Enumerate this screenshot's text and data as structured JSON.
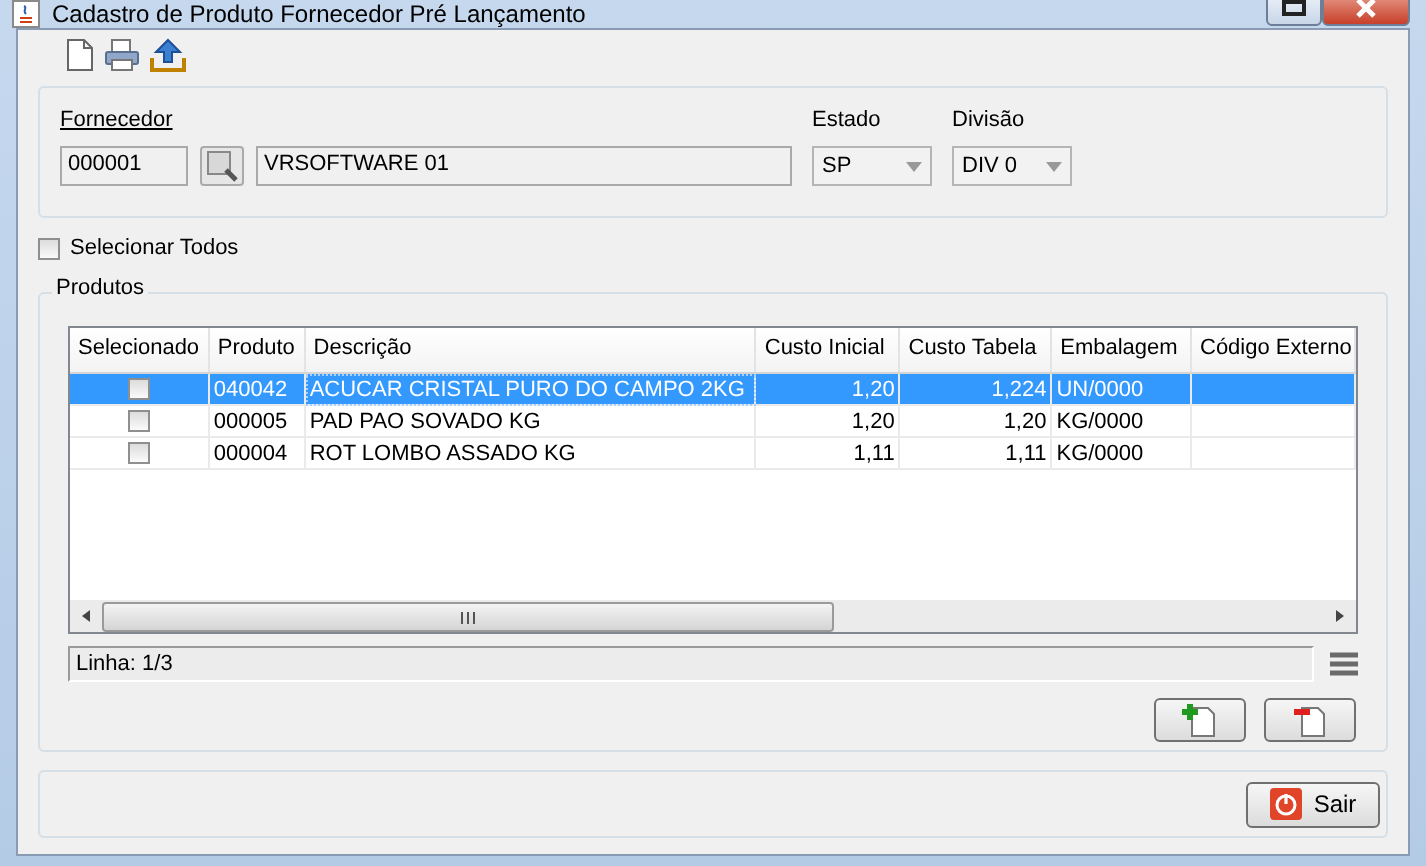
{
  "window": {
    "title": "Cadastro de Produto Fornecedor Pré Lançamento"
  },
  "fornecedor": {
    "label": "Fornecedor",
    "code": "000001",
    "name": "VRSOFTWARE 01"
  },
  "estado": {
    "label": "Estado",
    "value": "SP"
  },
  "divisao": {
    "label": "Divisão",
    "value": "DIV 0"
  },
  "select_all": {
    "label": "Selecionar Todos",
    "checked": false
  },
  "produtos": {
    "title": "Produtos",
    "table": {
      "columns": [
        "Selecionado",
        "Produto",
        "Descrição",
        "Custo Inicial",
        "Custo Tabela",
        "Embalagem",
        "Código Externo"
      ],
      "rows": [
        {
          "checked": false,
          "selected": true,
          "cells": [
            "",
            "040042",
            "ACUCAR CRISTAL PURO DO CAMPO 2KG",
            "1,20",
            "1,224",
            "UN/0000",
            ""
          ]
        },
        {
          "checked": false,
          "selected": false,
          "cells": [
            "",
            "000005",
            "PAD PAO SOVADO KG",
            "1,20",
            "1,20",
            "KG/0000",
            ""
          ]
        },
        {
          "checked": false,
          "selected": false,
          "cells": [
            "",
            "000004",
            "ROT LOMBO ASSADO KG",
            "1,11",
            "1,11",
            "KG/0000",
            ""
          ]
        }
      ]
    },
    "status": "Linha: 1/3"
  },
  "buttons": {
    "exit": "Sair"
  }
}
